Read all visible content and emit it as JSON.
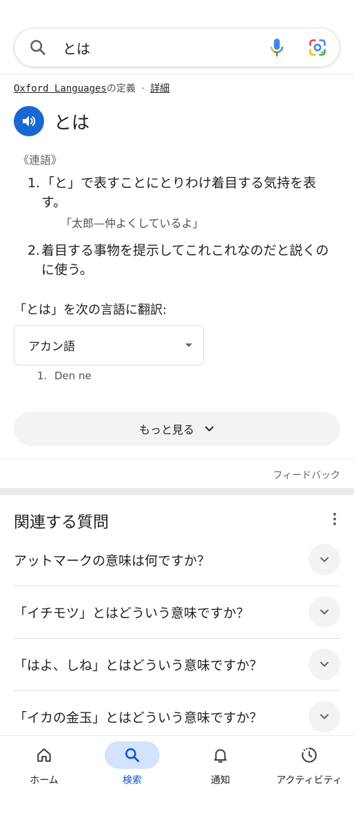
{
  "search": {
    "query": "とは",
    "icons": {
      "search": "search-icon",
      "mic": "mic-icon",
      "lens": "lens-icon"
    }
  },
  "definition": {
    "source_link": "Oxford Languages",
    "source_suffix": "の定義",
    "dot": "·",
    "details_link": "詳細",
    "word": "とは",
    "part_of_speech": "《連語》",
    "senses": [
      {
        "num": "1.",
        "text": "「と」で表すことにとりわけ着目する気持を表す。",
        "example": "「太郎—仲よくしているよ」"
      },
      {
        "num": "2.",
        "text": "着目する事物を提示してこれこれなのだと説くのに使う。"
      }
    ]
  },
  "translate": {
    "label": "「とは」を次の言語に翻訳:",
    "selected_language": "アカン語",
    "results": [
      {
        "num": "1.",
        "text": "Den ne"
      }
    ]
  },
  "more_button": "もっと見る",
  "feedback": "フィードバック",
  "related": {
    "title": "関連する質問",
    "questions": [
      "アットマークの意味は何ですか？",
      "「イチモツ」とはどういう意味ですか？",
      "「はよ、しね」とはどういう意味ですか？",
      "「イカの金玉」とはどういう意味ですか？"
    ]
  },
  "bottom_nav": [
    {
      "label": "ホーム",
      "icon": "home-icon"
    },
    {
      "label": "検索",
      "icon": "search-icon",
      "active": true
    },
    {
      "label": "通知",
      "icon": "bell-icon"
    },
    {
      "label": "アクティビティ",
      "icon": "activity-icon"
    }
  ],
  "colors": {
    "accent_blue": "#1967d2",
    "active_pill": "#d3e3fd",
    "active_label": "#0b57d0",
    "chip_bg": "#f1f3f4"
  }
}
